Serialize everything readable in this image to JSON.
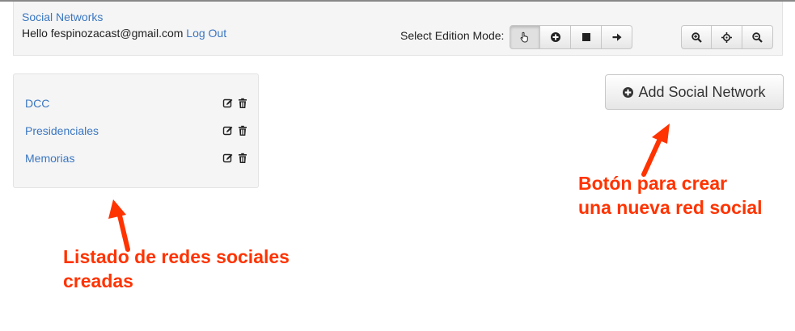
{
  "header": {
    "brand": "Social Networks",
    "hello_text": "Hello fespinozacast@gmail.com",
    "logout_label": "Log Out",
    "mode_label": "Select Edition Mode:",
    "mode_buttons": [
      {
        "icon": "hand-pointer-icon",
        "active": true
      },
      {
        "icon": "plus-circle-icon",
        "active": false
      },
      {
        "icon": "stop-square-icon",
        "active": false
      },
      {
        "icon": "arrow-right-icon",
        "active": false
      }
    ],
    "zoom_buttons": [
      {
        "icon": "zoom-in-icon"
      },
      {
        "icon": "crosshair-icon"
      },
      {
        "icon": "zoom-out-icon"
      }
    ]
  },
  "networks": {
    "items": [
      {
        "label": "DCC"
      },
      {
        "label": "Presidenciales"
      },
      {
        "label": "Memorias"
      }
    ],
    "row_icons": [
      "edit-icon",
      "trash-icon"
    ]
  },
  "add_button": {
    "label": "Add Social Network",
    "icon": "plus-circle-icon"
  },
  "annotations": {
    "right_line1": "Botón para crear",
    "right_line2": "una nueva red social",
    "left_line1": "Listado de redes sociales",
    "left_line2": "creadas"
  },
  "colors": {
    "link": "#3a76c1",
    "annotation": "#ff3300"
  }
}
